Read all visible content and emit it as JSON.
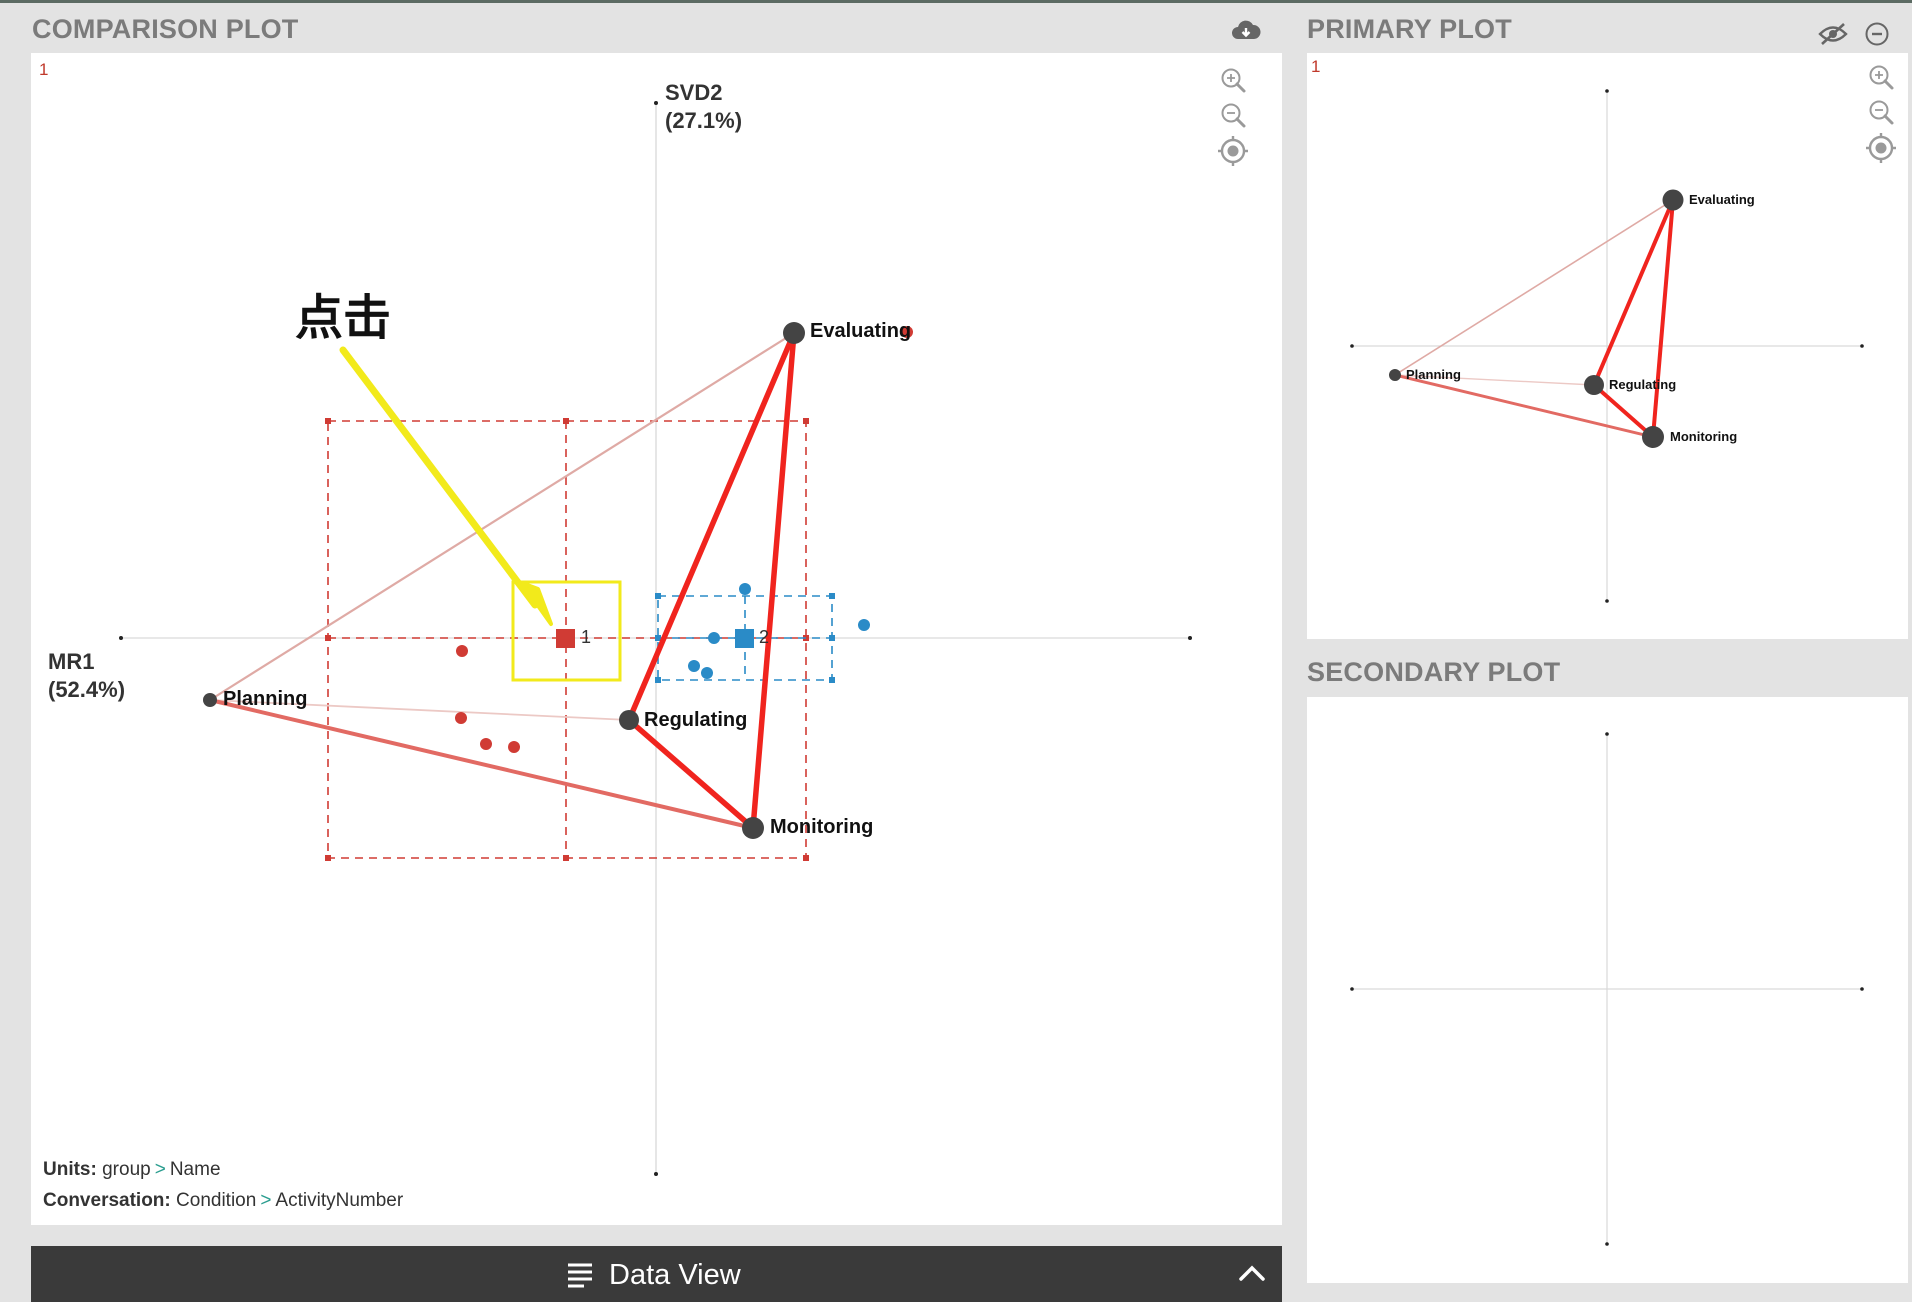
{
  "comparison": {
    "title": "COMPARISON PLOT",
    "corner_label": "1",
    "y_axis_name": "SVD2",
    "y_axis_pct": "(27.1%)",
    "x_axis_name": "MR1",
    "x_axis_pct": "(52.4%)",
    "nodes": {
      "evaluating": "Evaluating",
      "planning": "Planning",
      "regulating": "Regulating",
      "monitoring": "Monitoring"
    },
    "group_markers": {
      "red": "1",
      "blue": "2"
    },
    "units_label": "Units:",
    "units_a": "group",
    "units_b": "Name",
    "conversation_label": "Conversation:",
    "conversation_a": "Condition",
    "conversation_b": "ActivityNumber",
    "separator": ">",
    "annotation_text": "点击",
    "icons": [
      "cloud-download-icon",
      "zoom-in-icon",
      "zoom-out-icon",
      "target-icon"
    ]
  },
  "primary": {
    "title": "PRIMARY PLOT",
    "corner_label": "1",
    "nodes": {
      "evaluating": "Evaluating",
      "planning": "Planning",
      "regulating": "Regulating",
      "monitoring": "Monitoring"
    },
    "icons": [
      "eye-off-icon",
      "minus-circle-icon",
      "zoom-in-icon",
      "zoom-out-icon",
      "target-icon"
    ]
  },
  "secondary": {
    "title": "SECONDARY PLOT"
  },
  "data_view": {
    "label": "Data View",
    "icons": [
      "list-icon",
      "chevron-up-icon"
    ]
  },
  "colors": {
    "edge_strong": "#f0241e",
    "edge_medium": "#e26a63",
    "edge_light": "#dfaaa5",
    "group1": "#d03b34",
    "group2": "#2a8bc7",
    "highlight": "#f2ea1b",
    "node": "#444444"
  }
}
